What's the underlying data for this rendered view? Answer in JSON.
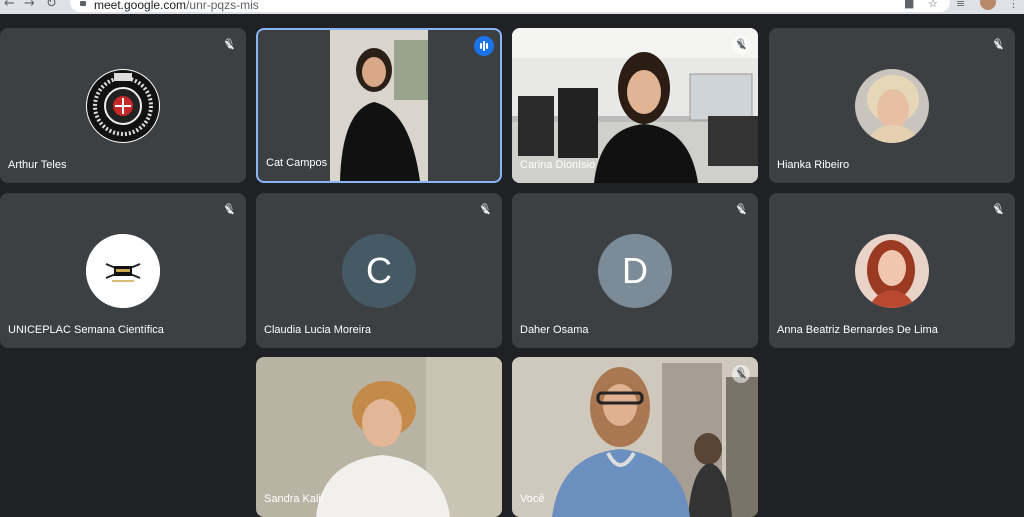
{
  "browser": {
    "url_domain": "meet.google.com",
    "url_path": "/unr-pqzs-mis",
    "icons": [
      "back-arrow-icon",
      "forward-arrow-icon",
      "reload-icon",
      "lock-icon",
      "camera-icon",
      "star-icon",
      "playlist-icon",
      "profile-icon",
      "menu-icon"
    ]
  },
  "meeting": {
    "participants": [
      {
        "name": "Arthur Teles",
        "avatar": "emblem-logo",
        "muted": true
      },
      {
        "name": "Cat Campos",
        "video": true,
        "speaking": true
      },
      {
        "name": "Carina Dionísio",
        "video": true,
        "muted": true
      },
      {
        "name": "Hianka Ribeiro",
        "avatar": "photo",
        "muted": true
      },
      {
        "name": "UNICEPLAC Semana Científica",
        "avatar": "logo",
        "muted": true
      },
      {
        "name": "Claudia Lucia Moreira",
        "initial": "C",
        "muted": true
      },
      {
        "name": "Daher Osama",
        "initial": "D",
        "muted": true
      },
      {
        "name": "Anna Beatriz Bernardes De Lima",
        "avatar": "photo",
        "muted": true
      },
      {
        "name": "Sandra Kalil",
        "video": true
      },
      {
        "name": "Você",
        "video": true,
        "muted": true
      }
    ]
  },
  "colors": {
    "background": "#202124",
    "tile": "#3c4043",
    "active_border": "#8ab4f8",
    "speaking_badge": "#1a73e8",
    "initial_c": "#455a64",
    "initial_d": "#7b8b97"
  }
}
